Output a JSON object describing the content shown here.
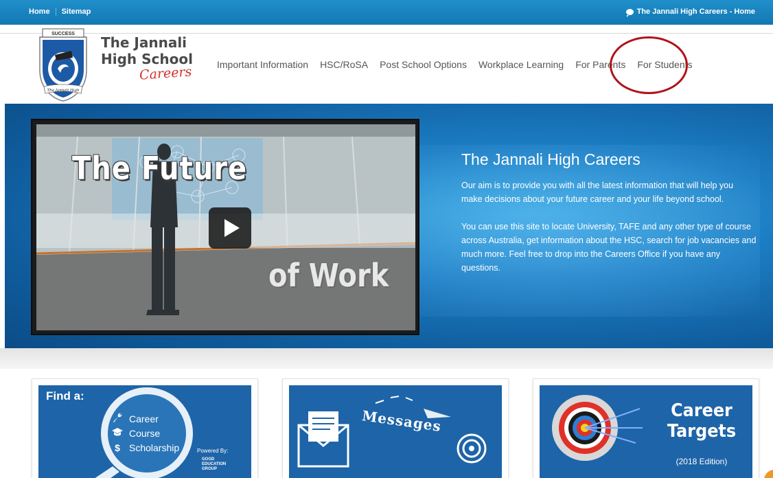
{
  "topbar": {
    "links": [
      "Home",
      "Sitemap"
    ],
    "right_text": "The Jannali High Careers - Home"
  },
  "logo": {
    "badge": "SUCCESS",
    "ribbon": "The Jannali High",
    "line1": "The Jannali",
    "line2": "High School",
    "line3": "Careers"
  },
  "nav": {
    "items": [
      "Important Information",
      "HSC/RoSA",
      "Post School Options",
      "Workplace Learning",
      "For Parents",
      "For Students"
    ]
  },
  "hero": {
    "video_title_1": "The Future",
    "video_title_2": "of Work",
    "title": "The Jannali High Careers",
    "paragraph1": "Our aim is to provide you with all the latest information that will help you make decisions about your future career and your life beyond school.",
    "paragraph2": "You can use this site to locate University, TAFE and any other type of course across Australia, get information about the HSC, search for job vacancies and much more. Feel free to drop into the Careers Office if you have any questions."
  },
  "tiles": {
    "find": {
      "label": "Find a:",
      "items": [
        "Career",
        "Course",
        "Scholarship"
      ],
      "icons": [
        "wrench-icon",
        "graduation-cap-icon",
        "dollar-icon"
      ],
      "dollar_glyph": "$",
      "powered_by": "Powered By:",
      "provider_line1": "GOOD",
      "provider_line2": "EDUCATION",
      "provider_line3": "GROUP"
    },
    "messages": {
      "label": "Messages"
    },
    "targets": {
      "title_line1": "Career",
      "title_line2": "Targets",
      "edition": "(2018 Edition)"
    }
  },
  "colors": {
    "topbar": "#1a86c2",
    "hero": "#1c7dc3",
    "tile": "#1e64a8",
    "highlight": "#b0131b",
    "logo_red": "#d32f2f"
  }
}
